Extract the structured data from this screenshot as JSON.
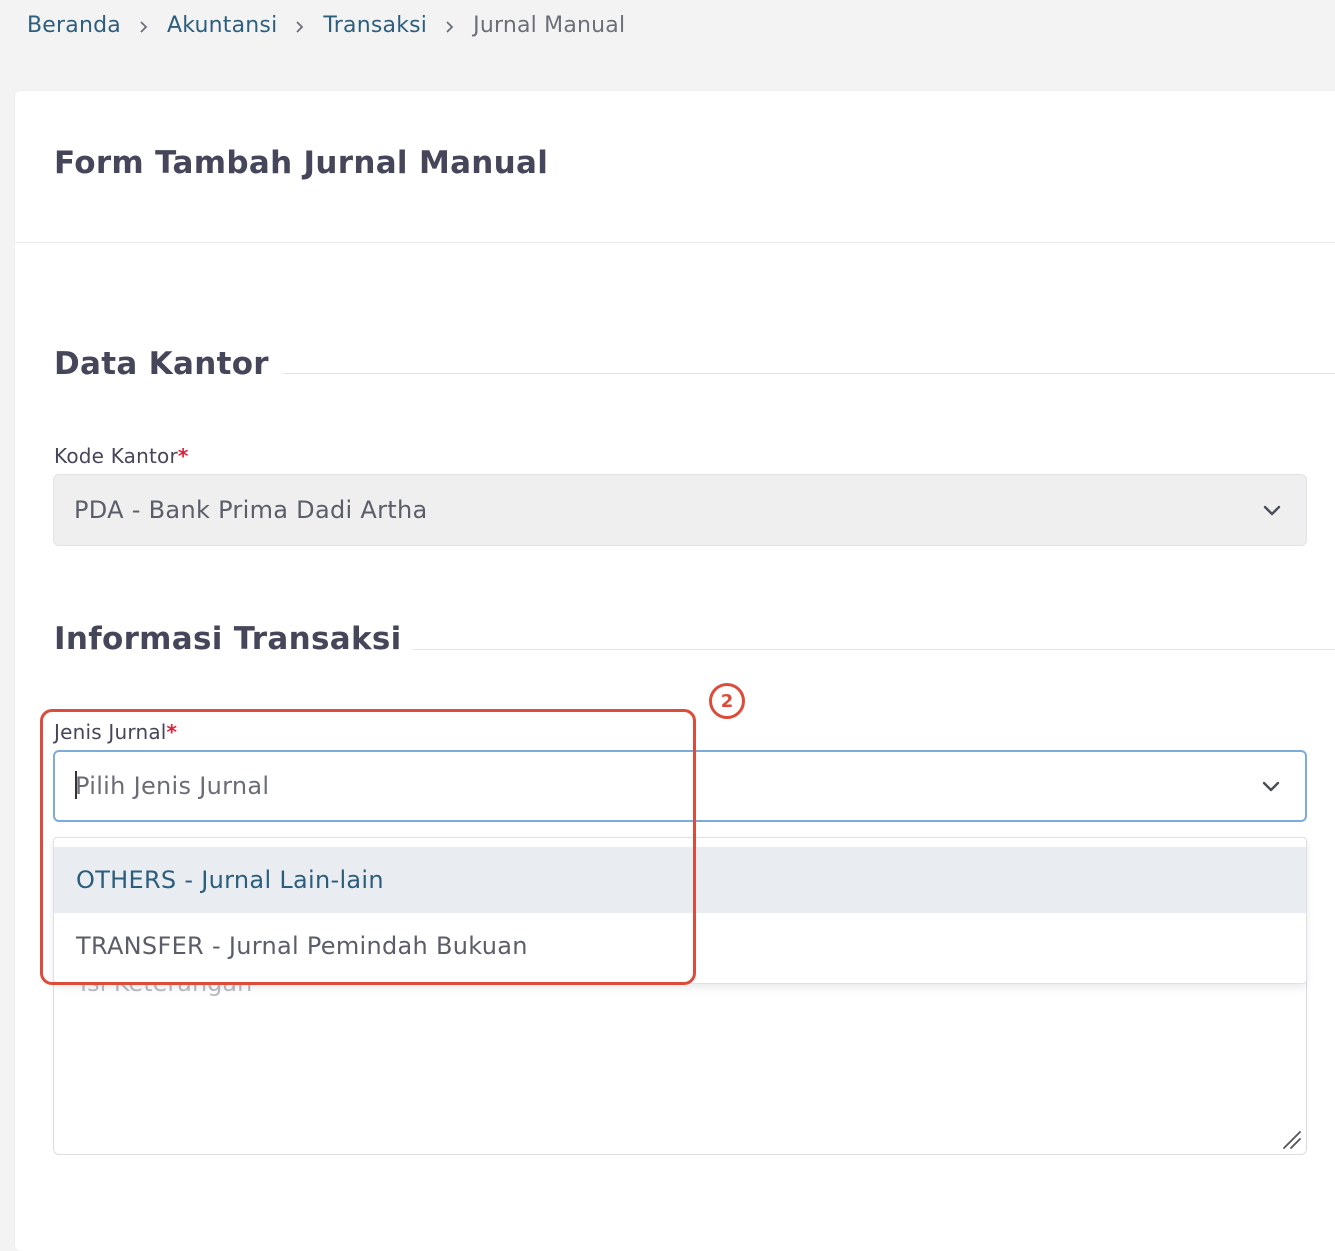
{
  "breadcrumb": {
    "items": [
      "Beranda",
      "Akuntansi",
      "Transaksi"
    ],
    "current": "Jurnal Manual"
  },
  "form": {
    "title": "Form Tambah Jurnal Manual"
  },
  "section_office": {
    "title": "Data Kantor",
    "office_code": {
      "label": "Kode Kantor",
      "required_mark": "*",
      "value": "PDA - Bank Prima Dadi Artha"
    }
  },
  "section_transaction": {
    "title": "Informasi Transaksi",
    "journal_type": {
      "label": "Jenis Jurnal",
      "required_mark": "*",
      "placeholder": "Pilih Jenis Jurnal",
      "options": [
        "OTHERS - Jurnal Lain-lain",
        "TRANSFER - Jurnal Pemindah Bukuan"
      ]
    },
    "description": {
      "placeholder": "Isi Keterangan"
    }
  },
  "annotation": {
    "badge": "2",
    "color": "#dd4b3a"
  },
  "colors": {
    "link": "#2d5f7d",
    "heading": "#45465a",
    "required": "#e0213a",
    "focus_border": "#7cacdc",
    "highlight_bg": "#e9edf2"
  },
  "icons": {
    "breadcrumb_separator": "chevron-right-icon",
    "select_arrow": "chevron-down-icon",
    "resize": "resize-handle-icon"
  }
}
